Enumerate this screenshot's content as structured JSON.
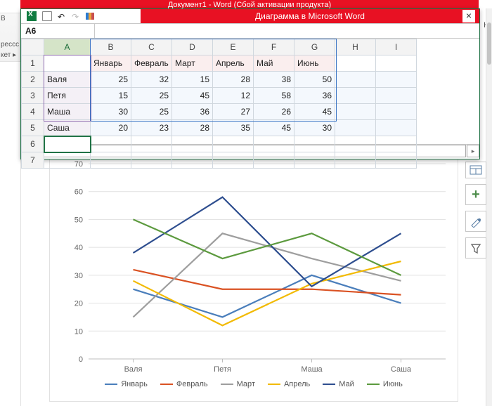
{
  "word_title": "Документ1 -  Word (Сбой активации продукта)",
  "chart_window_title": "Диаграмма в Microsoft Word",
  "name_box": "A6",
  "left_ribbon": {
    "l1": "В",
    "l2": "рессс",
    "l3": "кет ▸"
  },
  "right_edge_label": "Кс",
  "columns": [
    "A",
    "B",
    "C",
    "D",
    "E",
    "F",
    "G",
    "H",
    "I"
  ],
  "row_numbers": [
    "1",
    "2",
    "3",
    "4",
    "5",
    "6",
    "7"
  ],
  "header_row": [
    "",
    "Январь",
    "Февраль",
    "Март",
    "Апрель",
    "Май",
    "Июнь"
  ],
  "rows": [
    {
      "name": "Валя",
      "vals": [
        25,
        32,
        15,
        28,
        38,
        50
      ]
    },
    {
      "name": "Петя",
      "vals": [
        15,
        25,
        45,
        12,
        58,
        36
      ]
    },
    {
      "name": "Маша",
      "vals": [
        30,
        25,
        36,
        27,
        26,
        45
      ]
    },
    {
      "name": "Саша",
      "vals": [
        20,
        23,
        28,
        35,
        45,
        30
      ]
    }
  ],
  "chart_data": {
    "type": "line",
    "categories": [
      "Валя",
      "Петя",
      "Маша",
      "Саша"
    ],
    "series": [
      {
        "name": "Январь",
        "color": "#4A7EBB",
        "values": [
          25,
          15,
          30,
          20
        ]
      },
      {
        "name": "Февраль",
        "color": "#DA5223",
        "values": [
          32,
          25,
          25,
          23
        ]
      },
      {
        "name": "Март",
        "color": "#9E9E9E",
        "values": [
          15,
          45,
          36,
          28
        ]
      },
      {
        "name": "Апрель",
        "color": "#F2BA02",
        "values": [
          28,
          12,
          27,
          35
        ]
      },
      {
        "name": "Май",
        "color": "#2E4E8F",
        "values": [
          38,
          58,
          26,
          45
        ]
      },
      {
        "name": "Июнь",
        "color": "#5C9A3E",
        "values": [
          50,
          36,
          45,
          30
        ]
      }
    ],
    "ylim": [
      0,
      70
    ],
    "ytick": 10,
    "xlabel": "",
    "ylabel": "",
    "title": ""
  },
  "side_buttons": {
    "layout": "layout",
    "plus": "+",
    "brush": "brush",
    "filter": "filter"
  }
}
